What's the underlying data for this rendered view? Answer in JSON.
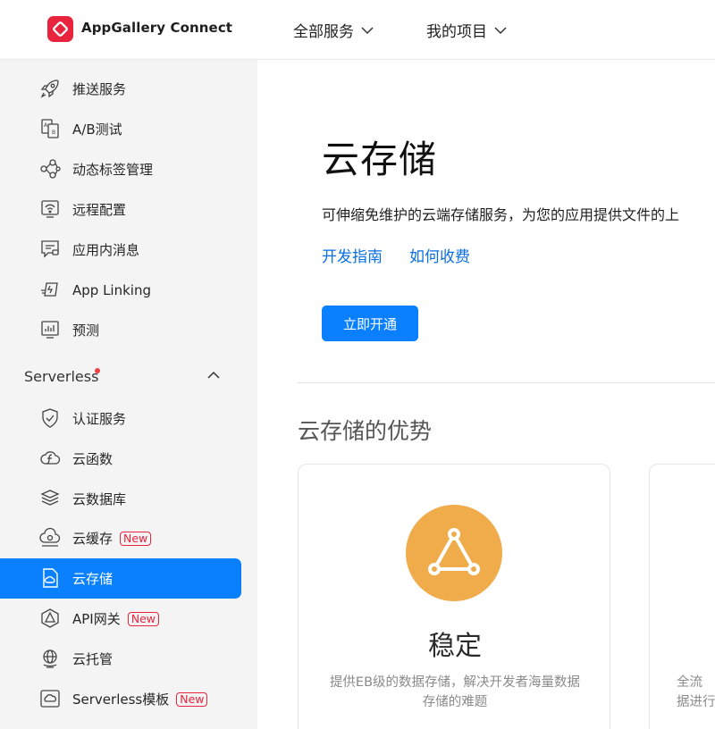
{
  "header": {
    "logo_text": "AppGallery Connect",
    "nav": [
      {
        "label": "全部服务"
      },
      {
        "label": "我的项目"
      }
    ]
  },
  "sidebar": {
    "items_top": [
      {
        "label": "推送服务",
        "icon": "rocket-icon"
      },
      {
        "label": "A/B测试",
        "icon": "ab-test-icon"
      },
      {
        "label": "动态标签管理",
        "icon": "nodes-icon"
      },
      {
        "label": "远程配置",
        "icon": "remote-config-icon"
      },
      {
        "label": "应用内消息",
        "icon": "message-icon"
      },
      {
        "label": "App Linking",
        "icon": "link-icon"
      },
      {
        "label": "预测",
        "icon": "chart-icon"
      }
    ],
    "section": {
      "label": "Serverless"
    },
    "items_serverless": [
      {
        "label": "认证服务",
        "icon": "shield-icon"
      },
      {
        "label": "云函数",
        "icon": "cloud-function-icon"
      },
      {
        "label": "云数据库",
        "icon": "database-icon"
      },
      {
        "label": "云缓存",
        "icon": "cloud-cache-icon",
        "badge": "New"
      },
      {
        "label": "云存储",
        "icon": "cloud-storage-icon",
        "active": true
      },
      {
        "label": "API网关",
        "icon": "api-gateway-icon",
        "badge": "New"
      },
      {
        "label": "云托管",
        "icon": "globe-icon"
      },
      {
        "label": "Serverless模板",
        "icon": "template-icon",
        "badge": "New"
      }
    ]
  },
  "main": {
    "title": "云存储",
    "description": "可伸缩免维护的云端存储服务，为您的应用提供文件的上",
    "links": [
      "开发指南",
      "如何收费"
    ],
    "button": "立即开通",
    "advantages_title": "云存储的优势",
    "cards": [
      {
        "title": "稳定",
        "desc": "提供EB级的数据存储，解决开发者海量数据存储的难题",
        "icon": "triangle-nodes-icon"
      },
      {
        "title": "",
        "desc": "全流\n据进行"
      }
    ]
  },
  "colors": {
    "accent": "#0a80ff",
    "brand_red": "#e8243f",
    "card_icon_bg": "#f0ab4b"
  }
}
